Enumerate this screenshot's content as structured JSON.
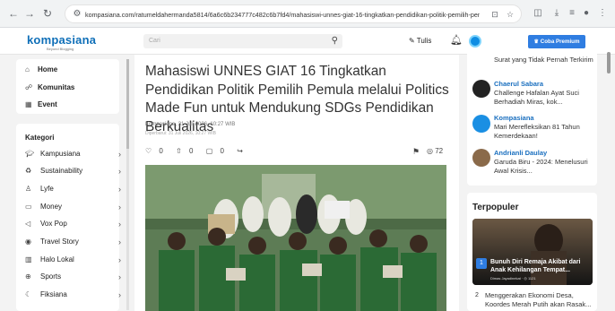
{
  "browser": {
    "url": "kompasiana.com/ratumeldahermanda5814/6a6c6b234777c482c6b7fd4/mahasiswi-unnes-giat-16-tingkatkan-pendidikan-politik-pemilih-pemula-..."
  },
  "header": {
    "logo": "kompasiana",
    "tagline": "Beyond Blogging",
    "search_placeholder": "Cari",
    "write_label": "Tulis",
    "premium_label": "Coba Premium"
  },
  "left_nav": {
    "items": [
      {
        "label": "Home",
        "icon": "home-icon"
      },
      {
        "label": "Komunitas",
        "icon": "community-icon"
      },
      {
        "label": "Event",
        "icon": "event-icon"
      }
    ]
  },
  "kategori": {
    "title": "Kategori",
    "items": [
      {
        "label": "Kampusiana",
        "icon": "graduation-icon"
      },
      {
        "label": "Sustainability",
        "icon": "sustainability-icon"
      },
      {
        "label": "Lyfe",
        "icon": "lyfe-icon"
      },
      {
        "label": "Money",
        "icon": "money-icon"
      },
      {
        "label": "Vox Pop",
        "icon": "megaphone-icon"
      },
      {
        "label": "Travel Story",
        "icon": "location-icon"
      },
      {
        "label": "Halo Lokal",
        "icon": "building-icon"
      },
      {
        "label": "Sports",
        "icon": "ball-icon"
      },
      {
        "label": "Fiksiana",
        "icon": "book-icon"
      }
    ]
  },
  "article": {
    "title": "Mahasiswi UNNES GIAT 16 Tingkatkan Pendidikan Politik Pemilih Pemula melalui Politics Made Fun untuk Mendukung SDGs Pendidikan Berkualitas",
    "published": "Kompasiana, 31 Juli 2026, 10:27 WIB",
    "updated": "Diperbarui: 31 Juli 2026, 10:27 WIB",
    "likes": "0",
    "votes": "0",
    "comments": "0",
    "views": "72"
  },
  "right_feed": {
    "items": [
      {
        "user": "",
        "text": "Surat yang Tidak Pernah Terkirim",
        "color": "#ffffff"
      },
      {
        "user": "Chaerul Sabara",
        "text": "Challenge Hafalan Ayat Suci Berhadiah Miras, kok...",
        "color": "#222222"
      },
      {
        "user": "Kompasiana",
        "text": "Mari Merefleksikan 81 Tahun Kemerdekaan!",
        "color": "#1a8fe3"
      },
      {
        "user": "Andrianli Daulay",
        "text": "Garuda Biru - 2024: Menelusuri Awal Krisis...",
        "color": "#8a6a4a"
      }
    ]
  },
  "terpopuler": {
    "title": "Terpopuler",
    "items": [
      {
        "rank": "1",
        "title": "Bunuh Diri Remaja Akibat dari Anak Kehilangan Tempat...",
        "author": "Dimas Jayadinekat",
        "views": "1121"
      },
      {
        "rank": "2",
        "title": "Menggerakan Ekonomi Desa, Koordes Merah Putih akan Rasak..."
      }
    ]
  }
}
